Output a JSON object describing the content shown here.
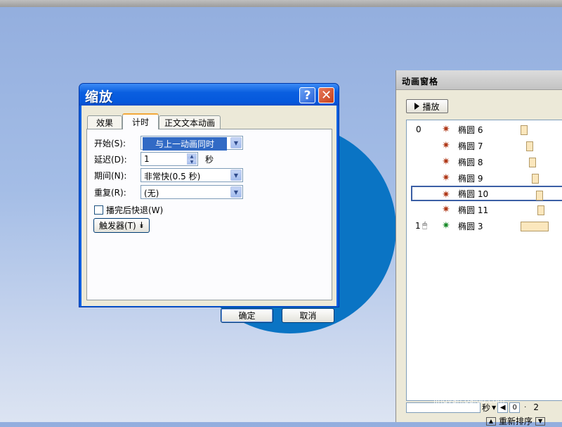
{
  "dialog": {
    "title": "缩放",
    "help_glyph": "?",
    "close_glyph": "✕",
    "tabs": [
      {
        "label": "效果"
      },
      {
        "label": "计时"
      },
      {
        "label": "正文文本动画"
      }
    ],
    "fields": {
      "start_label": "开始(S):",
      "start_value": "与上一动画同时",
      "delay_label": "延迟(D):",
      "delay_value": "1",
      "delay_unit": "秒",
      "duration_label": "期间(N):",
      "duration_value": "非常快(0.5 秒)",
      "repeat_label": "重复(R):",
      "repeat_value": "(无)",
      "rewind_label": "播完后快退(W)",
      "rewind_checked": false,
      "trigger_label": "触发器(T)"
    },
    "ok_label": "确定",
    "cancel_label": "取消"
  },
  "pane": {
    "title": "动画窗格",
    "play_label": "播放",
    "items": [
      {
        "num": "0",
        "name": "椭圆 6"
      },
      {
        "num": "",
        "name": "椭圆 7"
      },
      {
        "num": "",
        "name": "椭圆 8"
      },
      {
        "num": "",
        "name": "椭圆 9"
      },
      {
        "num": "",
        "name": "椭圆 10"
      },
      {
        "num": "",
        "name": "椭圆 11"
      },
      {
        "num": "1",
        "name": "椭圆 3"
      }
    ],
    "timeline_unit": "秒",
    "timeline_start": "0",
    "timeline_tick": "2",
    "reorder_label": "重新排序"
  },
  "watermark": "jingyan.baidu.com",
  "colors": {
    "circle": "#0a74c4",
    "title_bar": "#0a5fe0",
    "bar_fill": "#fbe7bd",
    "selection_border": "#3b5fa5"
  }
}
